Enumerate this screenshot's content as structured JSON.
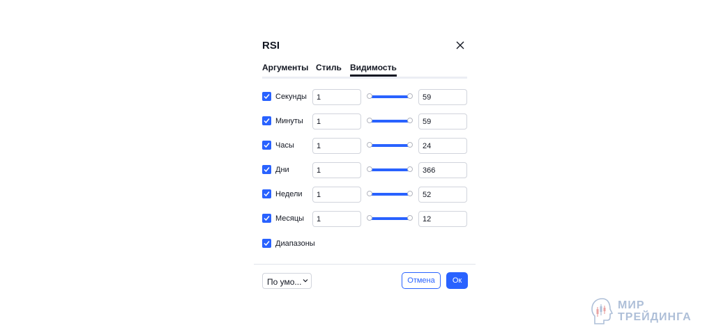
{
  "dialog": {
    "title": "RSI",
    "tabs": [
      {
        "label": "Аргументы",
        "active": false
      },
      {
        "label": "Стиль",
        "active": false
      },
      {
        "label": "Видимость",
        "active": true
      }
    ],
    "rows": [
      {
        "label": "Секунды",
        "checked": true,
        "from": "1",
        "to": "59"
      },
      {
        "label": "Минуты",
        "checked": true,
        "from": "1",
        "to": "59"
      },
      {
        "label": "Часы",
        "checked": true,
        "from": "1",
        "to": "24"
      },
      {
        "label": "Дни",
        "checked": true,
        "from": "1",
        "to": "366"
      },
      {
        "label": "Недели",
        "checked": true,
        "from": "1",
        "to": "52"
      },
      {
        "label": "Месяцы",
        "checked": true,
        "from": "1",
        "to": "12"
      }
    ],
    "ranges": {
      "label": "Диапазоны",
      "checked": true
    },
    "footer": {
      "preset_label": "По умо...",
      "cancel_label": "Отмена",
      "ok_label": "Ок"
    }
  },
  "watermark": {
    "line1": "МИР",
    "line2": "ТРЕЙДИНГА"
  },
  "colors": {
    "accent": "#2962ff",
    "text": "#131722",
    "border": "#d1d4dc",
    "watermark": "#aebfd8"
  },
  "icons": {
    "close": "close-icon",
    "check": "checkmark-icon",
    "dropdown": "chevron-down-icon",
    "watermark": "head-chart-logo-icon"
  }
}
